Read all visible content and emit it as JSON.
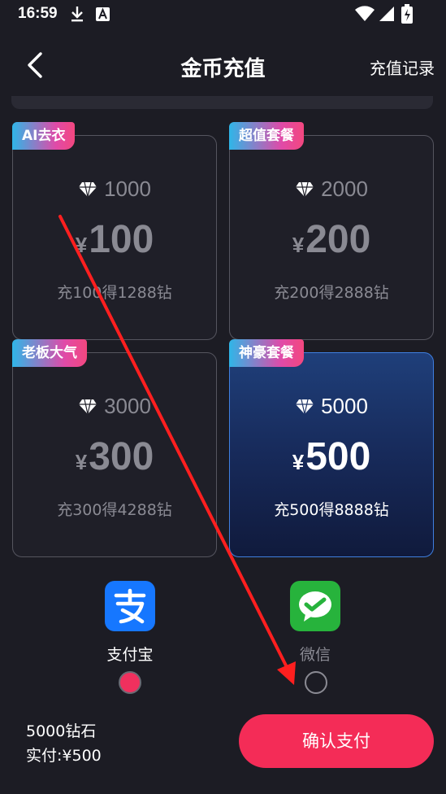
{
  "status_bar": {
    "time": "16:59",
    "icons": [
      "download-icon",
      "a-badge-icon",
      "wifi-icon",
      "signal-icon",
      "battery-icon"
    ]
  },
  "header": {
    "back_icon": "chevron-left-icon",
    "title": "金币充值",
    "records_label": "充值记录"
  },
  "packages": [
    {
      "tag": "AI去衣",
      "diamonds": "1000",
      "currency": "¥",
      "price": "100",
      "desc": "充100得1288钻",
      "selected": false
    },
    {
      "tag": "超值套餐",
      "diamonds": "2000",
      "currency": "¥",
      "price": "200",
      "desc": "充200得2888钻",
      "selected": false
    },
    {
      "tag": "老板大气",
      "diamonds": "3000",
      "currency": "¥",
      "price": "300",
      "desc": "充300得4288钻",
      "selected": false
    },
    {
      "tag": "神豪套餐",
      "diamonds": "5000",
      "currency": "¥",
      "price": "500",
      "desc": "充500得8888钻",
      "selected": true
    }
  ],
  "payment_methods": [
    {
      "label": "支付宝",
      "icon": "alipay-icon",
      "selected": true,
      "color": "#1677ff"
    },
    {
      "label": "微信",
      "icon": "wechat-pay-icon",
      "selected": false,
      "color": "#27b33c"
    }
  ],
  "summary": {
    "diamonds_line": "5000钻石",
    "pay_line": "实付:¥500"
  },
  "confirm_label": "确认支付",
  "colors": {
    "background": "#1c1c24",
    "accent": "#f42c57",
    "selected_border": "#3f7fe0"
  }
}
